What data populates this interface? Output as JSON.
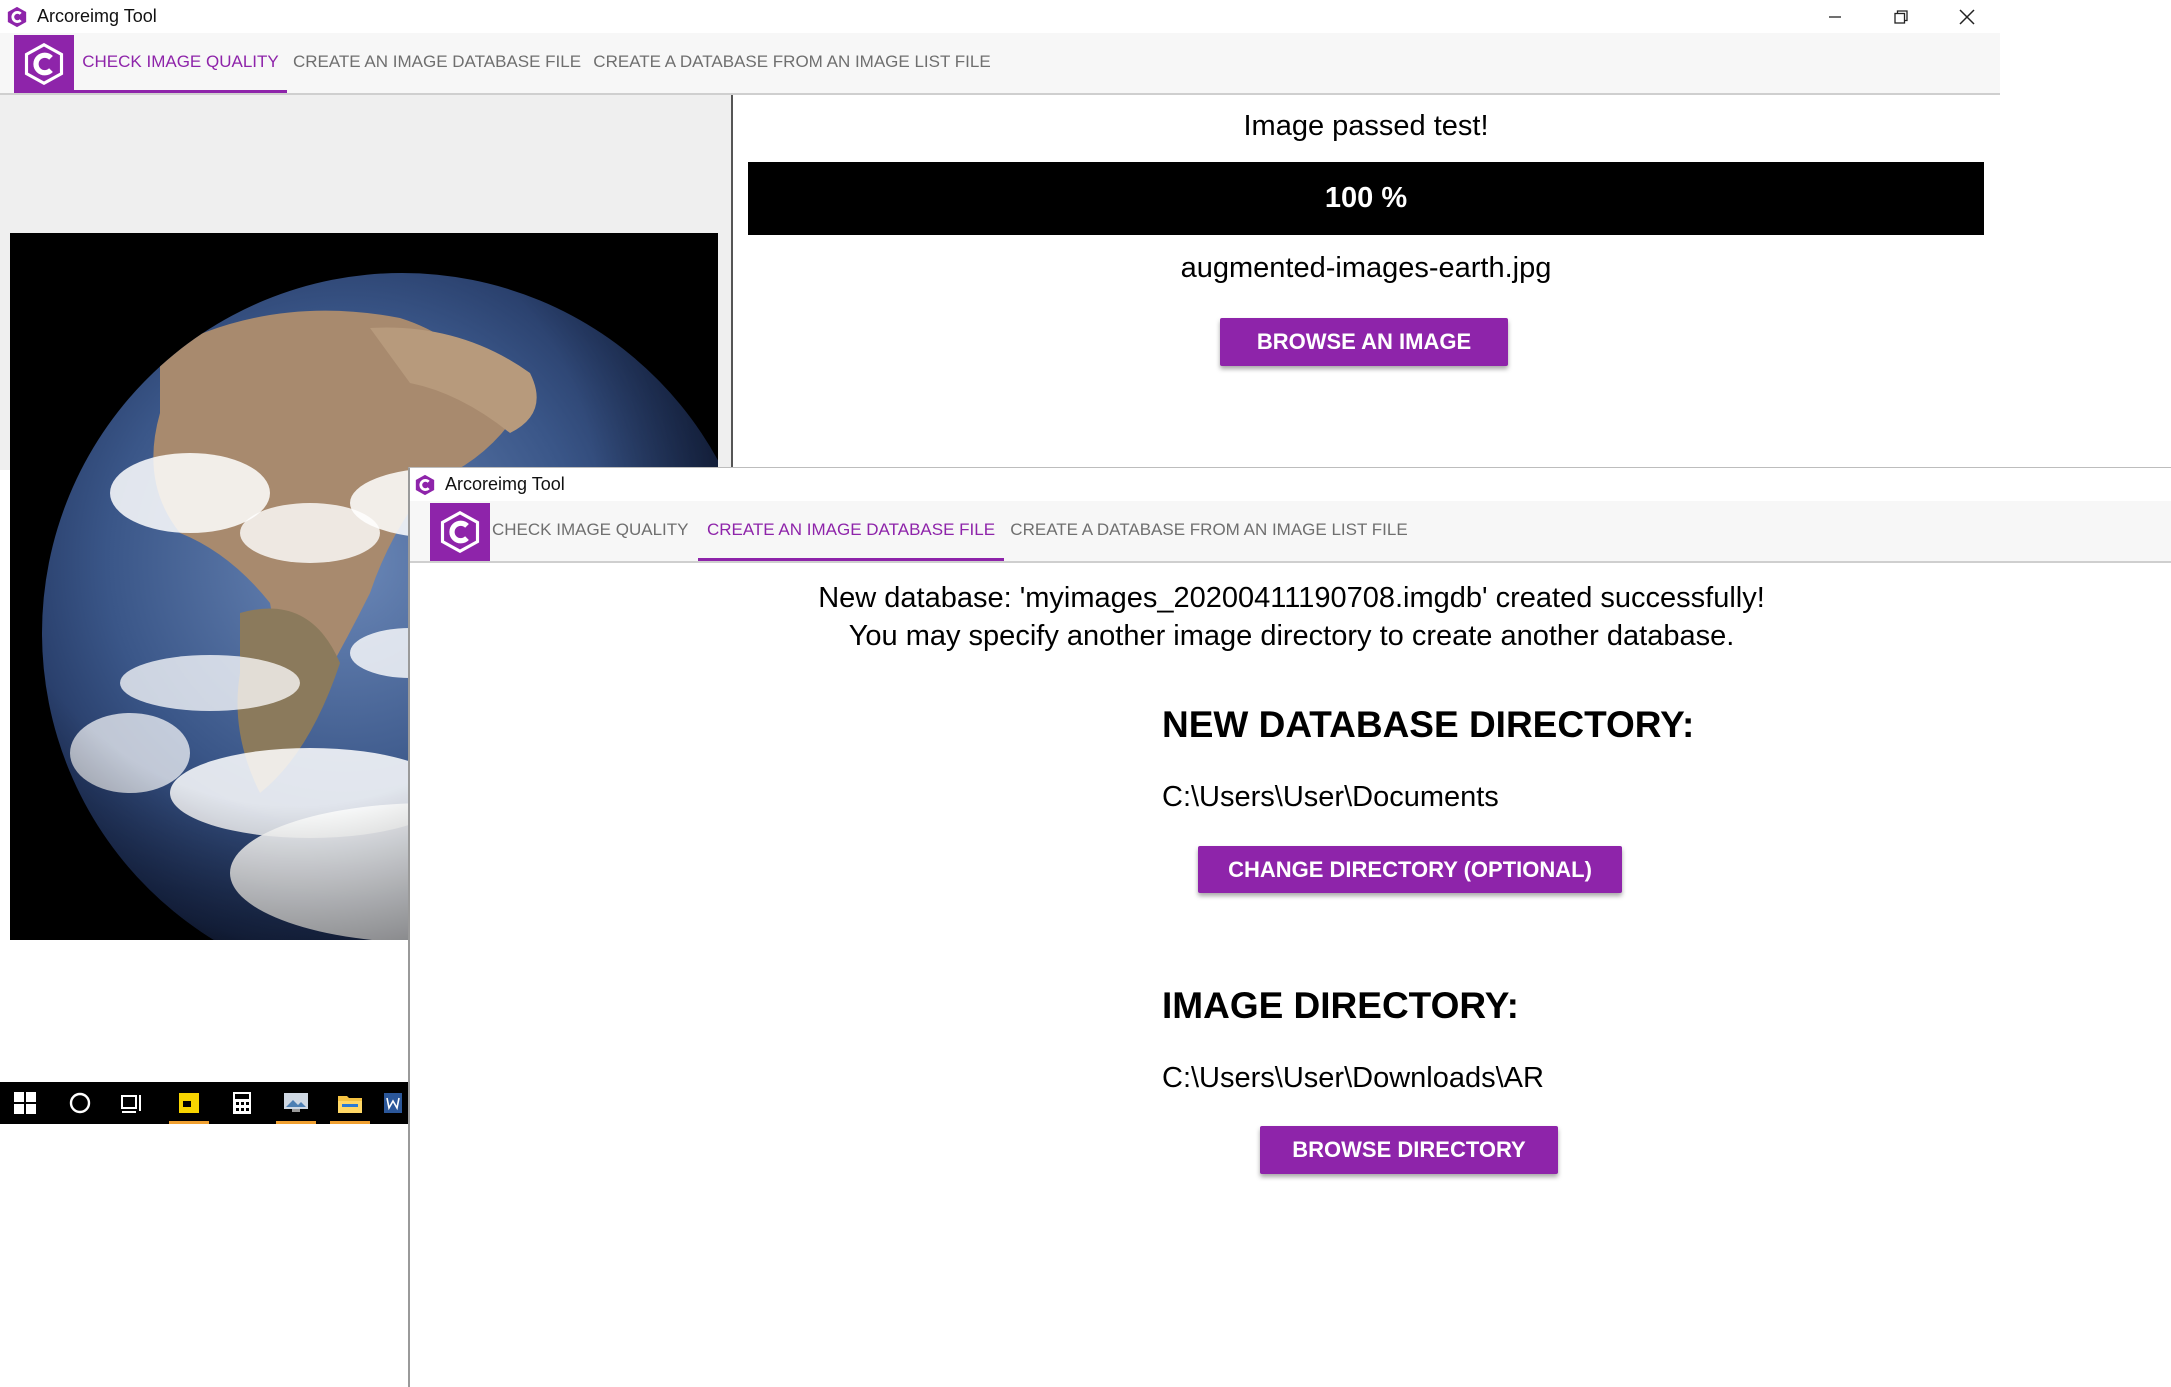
{
  "window1": {
    "title": "Arcoreimg Tool",
    "tabs": [
      {
        "label": "CHECK IMAGE QUALITY",
        "active": true
      },
      {
        "label": "CREATE AN IMAGE DATABASE FILE",
        "active": false
      },
      {
        "label": "CREATE A DATABASE FROM AN IMAGE LIST FILE",
        "active": false
      }
    ],
    "status": "Image passed test!",
    "progress": {
      "value": 100,
      "label": "100 %"
    },
    "filename": "augmented-images-earth.jpg",
    "browse_button": "BROWSE AN IMAGE",
    "preview_icon": "earth-photo"
  },
  "window2": {
    "title": "Arcoreimg Tool",
    "tabs": [
      {
        "label": "CHECK IMAGE QUALITY",
        "active": false
      },
      {
        "label": "CREATE AN IMAGE DATABASE FILE",
        "active": true
      },
      {
        "label": "CREATE A DATABASE FROM AN IMAGE LIST FILE",
        "active": false
      }
    ],
    "message_line1": "New database: 'myimages_20200411190708.imgdb' created successfully!",
    "message_line2": "You may specify another image directory to create another database.",
    "new_db_heading": "NEW DATABASE DIRECTORY:",
    "new_db_path": "C:\\Users\\User\\Documents",
    "change_button": "CHANGE DIRECTORY (OPTIONAL)",
    "image_dir_heading": "IMAGE DIRECTORY:",
    "image_dir_path": "C:\\Users\\User\\Downloads\\AR",
    "browse_dir_button": "BROWSE DIRECTORY"
  },
  "taskbar": {
    "icons": [
      "windows-start-icon",
      "search-circle-icon",
      "task-view-icon",
      "sticky-notes-icon",
      "calculator-icon",
      "photos-icon",
      "file-explorer-icon",
      "word-icon"
    ]
  },
  "colors": {
    "accent": "#8e24aa",
    "tab_inactive": "#6f6f6f",
    "progress_bar": "#000000",
    "panel_bg": "#efefef"
  }
}
